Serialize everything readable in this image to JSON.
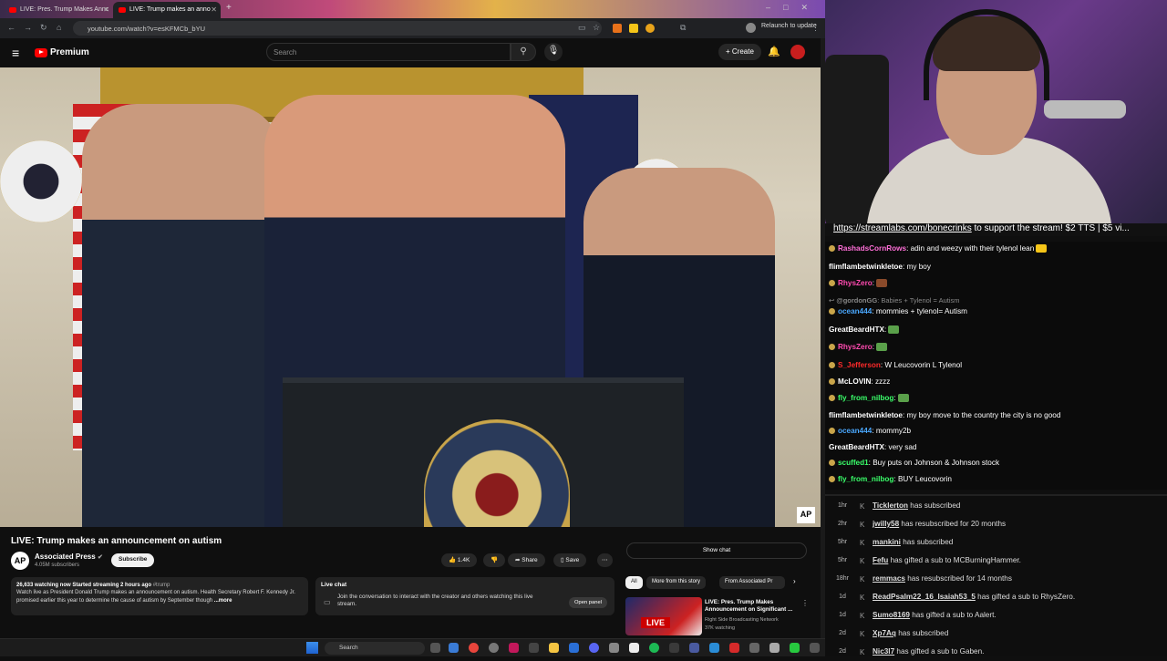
{
  "browser": {
    "tabs": [
      {
        "title": "LIVE: Pres. Trump Makes Annc"
      },
      {
        "title": "LIVE: Trump makes an anno"
      }
    ],
    "url": "youtube.com/watch?v=esKFMCb_bYU",
    "relaunch_label": "Relaunch to update"
  },
  "youtube": {
    "logo_label": "Premium",
    "search_placeholder": "Search",
    "create_label": "Create",
    "video": {
      "watermark": "AP",
      "title": "LIVE: Trump makes an announcement on autism",
      "channel": "Associated Press",
      "channel_avatar": "AP",
      "subscribers": "4.05M subscribers",
      "subscribe_label": "Subscribe",
      "likes": "1.4K",
      "share_label": "Share",
      "save_label": "Save",
      "desc_meta": "26,633 watching now  Started streaming 2 hours ago",
      "desc_tag": "#trump",
      "desc_text": "Watch live as President Donald Trump makes an announcement on autism. Health Secretary Robert F. Kennedy Jr. promised earlier this year to determine the cause of autism by September though",
      "desc_more": "...more"
    },
    "live_chat": {
      "title": "Live chat",
      "body": "Join the conversation to interact with the creator and others watching this live stream.",
      "open_panel": "Open panel"
    },
    "sidebar": {
      "show_chat": "Show chat",
      "chips": [
        "All",
        "More from this story",
        "From Associated Pr"
      ],
      "recommendation": {
        "thumb_badge": "LIVE",
        "title": "LIVE: Pres. Trump Makes Announcement on Significant ...",
        "channel": "Right Side Broadcasting Network",
        "views": "37K watching"
      }
    }
  },
  "taskbar": {
    "search_placeholder": "Search"
  },
  "stream": {
    "ticker_link": "https://streamlabs.com/bonecrinks",
    "ticker_text": " to support the stream! $2 TTS | $5 vi...",
    "chat": [
      {
        "user": "RashadsCornRows",
        "color": "#ff6fd8",
        "text": ": adin and weezy with their tylenol lean",
        "emote": "#f5c518"
      },
      {
        "user": "flimflambetwinkletoe",
        "color": "#ffffff",
        "text": ": my boy"
      },
      {
        "user": "RhysZero",
        "color": "#ff4ab0",
        "text": ":",
        "emote": "#8a4a2a"
      },
      {
        "user": "@gordonGG",
        "color": "#888888",
        "text": ": Babies + Tylenol = Autism",
        "reply": true
      },
      {
        "user": "ocean444",
        "color": "#4aa8ff",
        "text": ": mommies + tylenol= Autism"
      },
      {
        "user": "GreatBeardHTX",
        "color": "#ffffff",
        "text": ":",
        "emote": "#5aa04a"
      },
      {
        "user": "RhysZero",
        "color": "#ff4ab0",
        "text": ":",
        "emote": "#5aa04a"
      },
      {
        "user": "S_Jefferson",
        "color": "#ff2a2a",
        "text": ": W Leucovorin L Tylenol"
      },
      {
        "user": "McLOVIN",
        "color": "#ffffff",
        "text": ": zzzz"
      },
      {
        "user": "fly_from_nilbog",
        "color": "#3aff6a",
        "text": ":",
        "emote": "#5aa04a"
      },
      {
        "user": "flimflambetwinkletoe",
        "color": "#ffffff",
        "text": ": my boy move to the country the city is no good"
      },
      {
        "user": "ocean444",
        "color": "#4aa8ff",
        "text": ": mommy2b"
      },
      {
        "user": "GreatBeardHTX",
        "color": "#ffffff",
        "text": ": very sad"
      },
      {
        "user": "scuffed1",
        "color": "#3aff6a",
        "text": ": Buy puts on Johnson & Johnson stock"
      },
      {
        "user": "fly_from_nilbog",
        "color": "#3aff6a",
        "text": ": BUY Leucovorin"
      }
    ],
    "events": [
      {
        "time": "1hr",
        "name": "Ticklerton",
        "text": " has subscribed"
      },
      {
        "time": "2hr",
        "name": "jwilly58",
        "text": " has resubscribed for 20 months"
      },
      {
        "time": "5hr",
        "name": "mankini",
        "text": " has subscribed"
      },
      {
        "time": "5hr",
        "name": "Fefu",
        "text": " has gifted a sub to MCBurningHammer."
      },
      {
        "time": "18hr",
        "name": "remmacs",
        "text": " has resubscribed for 14 months"
      },
      {
        "time": "1d",
        "name": "ReadPsalm22_16_Isaiah53_5",
        "text": " has gifted a sub to RhysZero."
      },
      {
        "time": "1d",
        "name": "Sumo8169",
        "text": " has gifted a sub to Aalert."
      },
      {
        "time": "2d",
        "name": "Xp7Aq",
        "text": " has subscribed"
      },
      {
        "time": "2d",
        "name": "Nic3l7",
        "text": " has gifted a sub to Gaben."
      }
    ]
  }
}
